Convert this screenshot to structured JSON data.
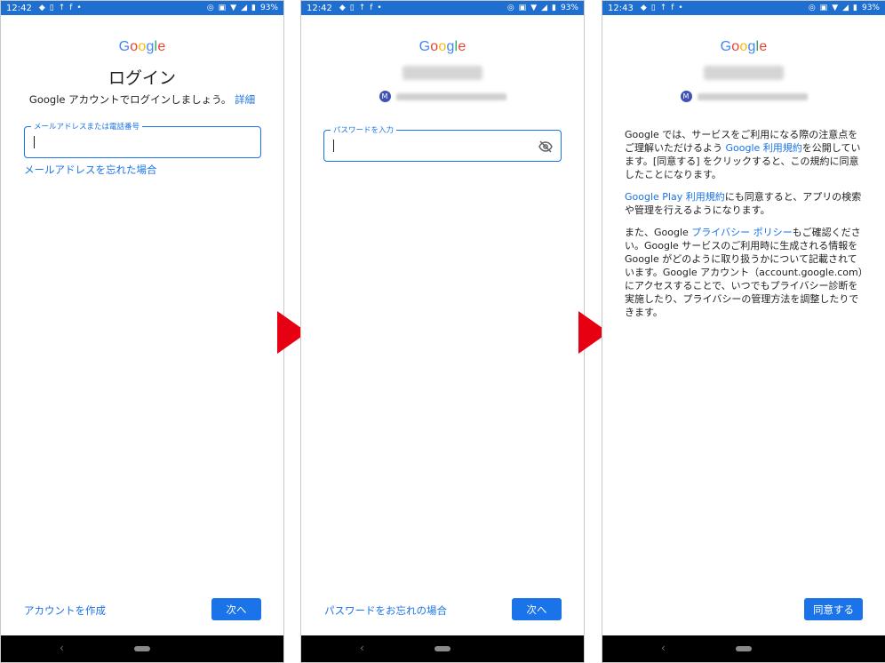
{
  "colors": {
    "accent": "#1a73e8",
    "statusbar": "#1f6fd1",
    "arrow": "#e60012"
  },
  "screens": [
    {
      "status": {
        "time": "12:42",
        "battery": "93%"
      },
      "logo": "Google",
      "title": "ログイン",
      "subtitle": "Google アカウントでログインしましょう。",
      "details_link": "詳細",
      "field_label": "メールアドレスまたは電話番号",
      "forgot": "メールアドレスを忘れた場合",
      "create_account": "アカウントを作成",
      "next": "次へ"
    },
    {
      "status": {
        "time": "12:42",
        "battery": "93%"
      },
      "logo": "Google",
      "account_initial": "M",
      "field_label": "パスワードを入力",
      "forgot": "パスワードをお忘れの場合",
      "next": "次へ"
    },
    {
      "status": {
        "time": "12:43",
        "battery": "93%"
      },
      "logo": "Google",
      "account_initial": "M",
      "para1": {
        "a": "Google では、サービスをご利用になる際の注意点をご理解いただけるよう ",
        "link": "Google 利用規約",
        "b": "を公開しています。[同意する] をクリックすると、この規約に同意したことになります。"
      },
      "para2": {
        "link": "Google Play 利用規約",
        "b": "にも同意すると、アプリの検索や管理を行えるようになります。"
      },
      "para3": {
        "a": "また、Google ",
        "link": "プライバシー ポリシー",
        "b": "もご確認ください。Google サービスのご利用時に生成される情報を Google がどのように取り扱うかについて記載されています。Google アカウント（account.google.com）にアクセスすることで、いつでもプライバシー診断を実施したり、プライバシーの管理方法を調整したりできます。"
      },
      "agree": "同意する"
    }
  ]
}
